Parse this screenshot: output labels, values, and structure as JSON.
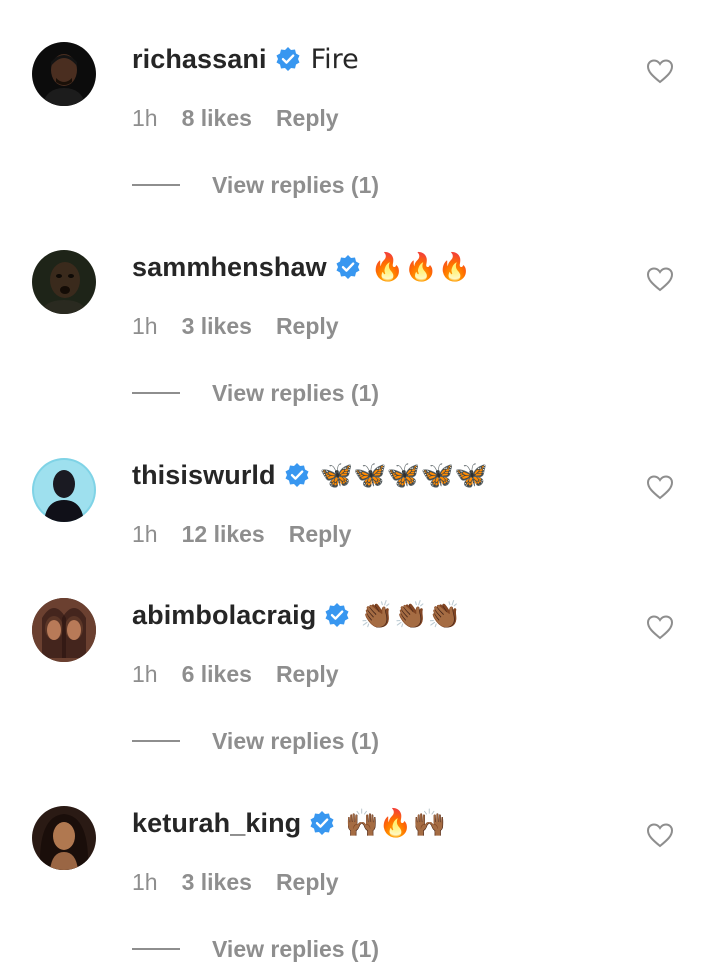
{
  "comments": [
    {
      "username": "richassani",
      "verified": true,
      "text": "Fire",
      "time": "1h",
      "likes": "8 likes",
      "reply": "Reply",
      "view_replies": "View replies (1)",
      "avatar_icon": "avatar-photo"
    },
    {
      "username": "sammhenshaw",
      "verified": true,
      "text": "🔥🔥🔥",
      "time": "1h",
      "likes": "3 likes",
      "reply": "Reply",
      "view_replies": "View replies (1)",
      "avatar_icon": "avatar-photo"
    },
    {
      "username": "thisiswurld",
      "verified": true,
      "text": "🦋🦋🦋🦋🦋",
      "time": "1h",
      "likes": "12 likes",
      "reply": "Reply",
      "view_replies": "",
      "avatar_icon": "avatar-photo"
    },
    {
      "username": "abimbolacraig",
      "verified": true,
      "text": "👏🏾👏🏾👏🏾",
      "time": "1h",
      "likes": "6 likes",
      "reply": "Reply",
      "view_replies": "View replies (1)",
      "avatar_icon": "avatar-photo"
    },
    {
      "username": "keturah_king",
      "verified": true,
      "text": "🙌🏾🔥🙌🏾",
      "time": "1h",
      "likes": "3 likes",
      "reply": "Reply",
      "view_replies": "View replies (1)",
      "avatar_icon": "avatar-photo"
    }
  ],
  "colors": {
    "username": "#262626",
    "meta": "#8e8e8e",
    "verified": "#3897f0",
    "heart_outline": "#8e8e8e"
  },
  "icons": {
    "verified": "verified-badge-icon",
    "like": "heart-outline-icon"
  }
}
